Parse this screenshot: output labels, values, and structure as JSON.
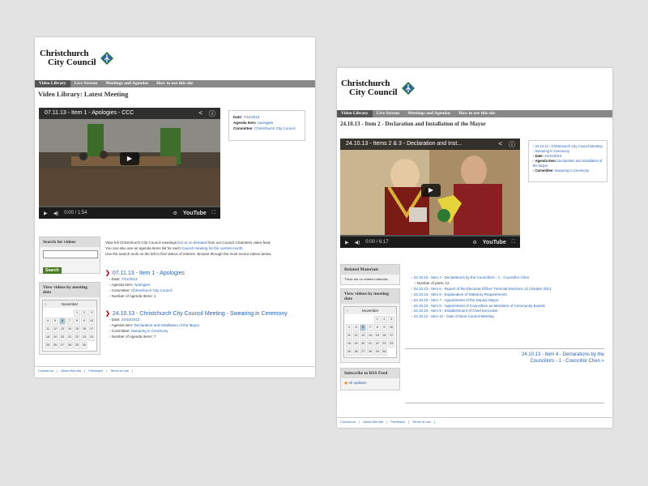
{
  "brand": {
    "name_line1": "Christchurch",
    "name_line2": "City Council"
  },
  "nav": [
    "Video Library",
    "Live Stream",
    "Meetings and Agendas",
    "How to use this site"
  ],
  "page1": {
    "title": "Video Library: Latest Meeting",
    "video": {
      "title": "07.11.13 - Item 1 - Apologies - CCC",
      "time": "0:00 / 1:54"
    },
    "info": {
      "date_label": "Date:",
      "date": "7/11/2013",
      "agenda_label": "Agenda Item:",
      "agenda": "Apologies",
      "committee_label": "Committee:",
      "committee": "Christchurch City Council"
    },
    "search": {
      "heading": "Search for videos",
      "button": "Search"
    },
    "calendar": {
      "heading": "View videos by meeting date",
      "month": "November",
      "days": [
        "",
        "",
        "",
        "",
        "1",
        "2",
        "3",
        "4",
        "5",
        "6",
        "7",
        "8",
        "9",
        "10",
        "11",
        "12",
        "13",
        "14",
        "15",
        "16",
        "17",
        "18",
        "19",
        "20",
        "21",
        "22",
        "23",
        "24",
        "25",
        "26",
        "27",
        "28",
        "29",
        "30",
        ""
      ]
    },
    "intro": {
      "l1a": "View full Christchurch City Council meetings",
      "l1b": "live",
      "l1c": "or",
      "l1d": "on demand",
      "l1e": "from our Council Chambers video feed.",
      "l2a": "You can also see an agenda items list for each",
      "l2b": "Council meeting for the current month.",
      "l3": "Use the search tools on the left to find videos of interest. Browse through the most recent videos below."
    },
    "items": [
      {
        "title": "07.11.13 - Item 1 - Apologies",
        "date_label": "Date:",
        "date": "7/11/2013",
        "agenda_label": "Agenda Item:",
        "agenda": "Apologies",
        "committee_label": "Committee:",
        "committee": "Christchurch City Council",
        "count_label": "Number of Agenda Items:",
        "count": "1"
      },
      {
        "title": "24.10.13 - Christchurch City Council Meeting - Swearing in Ceremony",
        "date_label": "Date:",
        "date": "24/10/2013",
        "agenda_label": "Agenda Item:",
        "agenda": "Declaration and Installation of the Mayor",
        "committee_label": "Committee:",
        "committee": "Swearing in Ceremony",
        "count_label": "Number of Agenda Items:",
        "count": "7"
      }
    ],
    "footer": [
      "Contact us",
      "|",
      "About this site",
      "|",
      "Feedback",
      "|",
      "Terms of use",
      "|"
    ]
  },
  "page2": {
    "title": "24.10.13 - Item 2 - Declaration and Installation of the Mayor",
    "video": {
      "title": "24.10.13 - Items 2 & 3 - Declaration and Inst...",
      "time": "0:00 / 6:17"
    },
    "info": {
      "item": "24.10.13 - Christchurch City Council Meeting - Swearing in Ceremony",
      "date_label": "Date:",
      "date": "24/10/2013",
      "agenda_label": "Agenda Item:",
      "agenda": "Declaration and Installation of the Mayor",
      "committee_label": "Committee:",
      "committee": "Swearing in Ceremony"
    },
    "related": {
      "heading": "Related Materials",
      "text": "There are no related materials"
    },
    "calendar": {
      "heading": "View videos by meeting date",
      "month": "November"
    },
    "rss": {
      "heading": "Subscribe to RSS Feed",
      "link": "All updates"
    },
    "list": [
      "24.10.13 - Item 4 - Declarations by the Councillors - 1 - Councillor Chen",
      "Number of parts: 12",
      "24.10.13 - Item 5 - Report of the Electoral Officer Triennial Elections 12 October 2013",
      "24.10.13 - Item 6 - Explanation of Statutory Requirements",
      "24.10.13 - Item 7 - Appointment of the Deputy Mayor",
      "24.10.13 - Item 8 - Appointment of Councillors as Members of Community Boards",
      "24.10.13 - Item 9 - Establishment of Chief Executive",
      "24.10.13 - Item 10 - Date of Next Council Meeting"
    ],
    "next_l1": "24.10.13 - Item 4 - Declarations by the",
    "next_l2": "Councillors - 1 - Councillor Chen »",
    "footer": [
      "Contact us",
      "|",
      "About this site",
      "|",
      "Feedback",
      "|",
      "Terms of use",
      "|"
    ]
  },
  "video_controls": {
    "youtube": "YouTube"
  }
}
